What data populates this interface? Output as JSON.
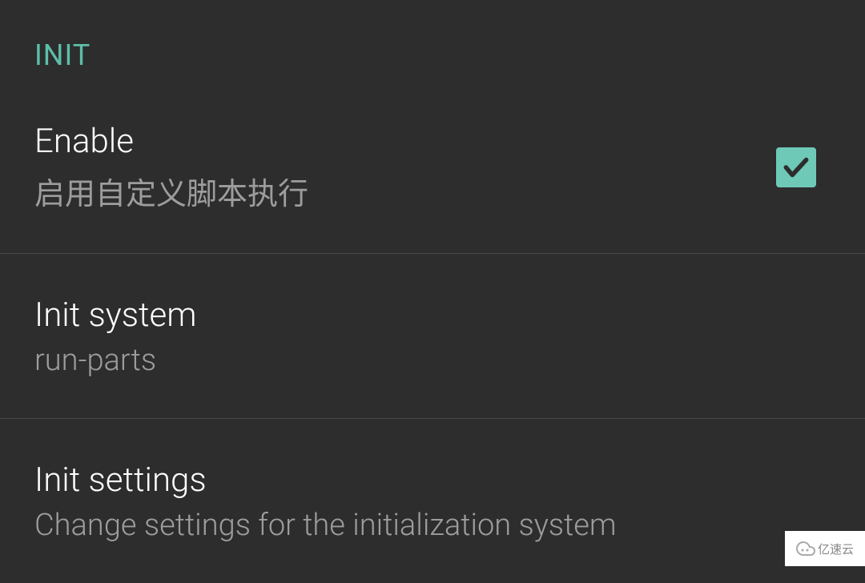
{
  "section": {
    "header": "INIT"
  },
  "settings": {
    "enable": {
      "title": "Enable",
      "subtitle": "启用自定义脚本执行",
      "checked": true
    },
    "init_system": {
      "title": "Init system",
      "subtitle": "run-parts"
    },
    "init_settings": {
      "title": "Init settings",
      "subtitle": "Change settings for the initialization system"
    }
  },
  "watermark": {
    "text": "亿速云"
  },
  "colors": {
    "background": "#2d2d2d",
    "accent": "#5cbfaa",
    "checkbox": "#6ec9b7",
    "text_primary": "#ffffff",
    "text_secondary": "#9d9d9d",
    "divider": "#4a4a4a"
  }
}
